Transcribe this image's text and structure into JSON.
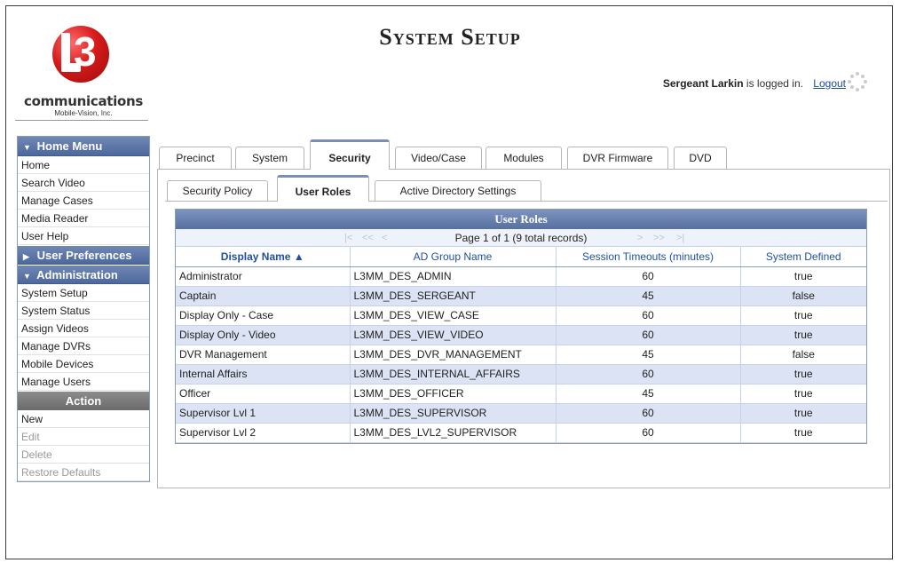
{
  "header": {
    "title": "System Setup",
    "logo_name": "communications",
    "logo_sub": "Mobile-Vision, Inc.",
    "user_name": "Sergeant Larkin",
    "login_suffix": "is logged in.",
    "logout_label": "Logout"
  },
  "sidebar": {
    "home_menu": {
      "label": "Home Menu",
      "items": [
        "Home",
        "Search Video",
        "Manage Cases",
        "Media Reader",
        "User Help"
      ]
    },
    "user_prefs": {
      "label": "User Preferences"
    },
    "administration": {
      "label": "Administration",
      "items": [
        "System Setup",
        "System Status",
        "Assign Videos",
        "Manage DVRs",
        "Mobile Devices",
        "Manage Users"
      ]
    },
    "action": {
      "label": "Action",
      "items": [
        {
          "label": "New",
          "enabled": true
        },
        {
          "label": "Edit",
          "enabled": false
        },
        {
          "label": "Delete",
          "enabled": false
        },
        {
          "label": "Restore Defaults",
          "enabled": false
        }
      ]
    }
  },
  "tabs": [
    "Precinct",
    "System",
    "Security",
    "Video/Case",
    "Modules",
    "DVR Firmware",
    "DVD"
  ],
  "active_tab": "Security",
  "subtabs": [
    "Security Policy",
    "User Roles",
    "Active Directory Settings"
  ],
  "active_subtab": "User Roles",
  "grid": {
    "title": "User Roles",
    "pager_text": "Page 1 of 1 (9 total records)",
    "columns": [
      "Display Name ▲",
      "AD Group Name",
      "Session Timeouts (minutes)",
      "System Defined"
    ],
    "rows": [
      [
        "Administrator",
        "L3MM_DES_ADMIN",
        "60",
        "true"
      ],
      [
        "Captain",
        "L3MM_DES_SERGEANT",
        "45",
        "false"
      ],
      [
        "Display Only - Case",
        "L3MM_DES_VIEW_CASE",
        "60",
        "true"
      ],
      [
        "Display Only - Video",
        "L3MM_DES_VIEW_VIDEO",
        "60",
        "true"
      ],
      [
        "DVR Management",
        "L3MM_DES_DVR_MANAGEMENT",
        "45",
        "false"
      ],
      [
        "Internal Affairs",
        "L3MM_DES_INTERNAL_AFFAIRS",
        "60",
        "true"
      ],
      [
        "Officer",
        "L3MM_DES_OFFICER",
        "45",
        "true"
      ],
      [
        "Supervisor Lvl 1",
        "L3MM_DES_SUPERVISOR",
        "60",
        "true"
      ],
      [
        "Supervisor Lvl 2",
        "L3MM_DES_LVL2_SUPERVISOR",
        "60",
        "true"
      ]
    ]
  },
  "colors": {
    "accent": "#5870a0",
    "link": "#1f4fa8",
    "row_alt": "#dbe3f4"
  }
}
